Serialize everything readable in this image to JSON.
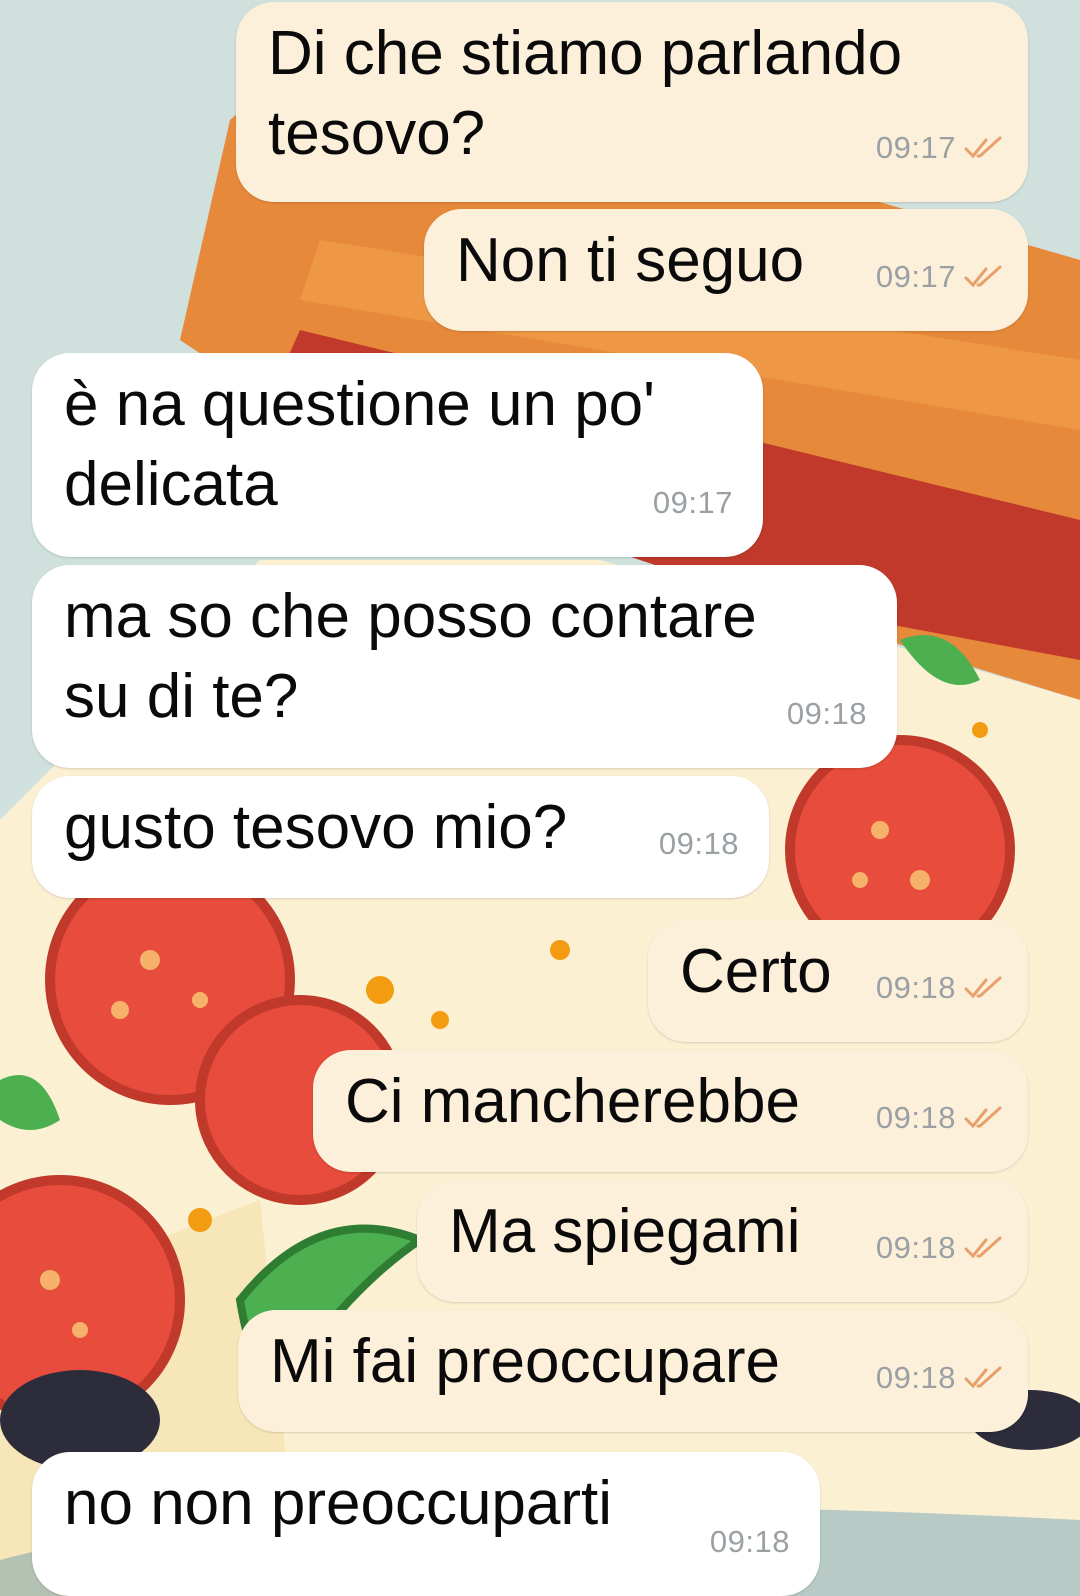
{
  "theme": {
    "outgoing_bubble": "#fdf0db",
    "incoming_bubble": "#ffffff",
    "time_color": "#9aa0a3",
    "tick_color": "#e8a06a"
  },
  "messages": [
    {
      "dir": "out",
      "text": "Di che stiamo parlando\ntesovo?",
      "time": "09:17",
      "status": "read-ticks-icon"
    },
    {
      "dir": "out",
      "text": "Non ti seguo",
      "time": "09:17",
      "status": "read-ticks-icon"
    },
    {
      "dir": "in",
      "text": "è na questione un po'\ndelicata",
      "time": "09:17"
    },
    {
      "dir": "in",
      "text": "ma so che posso contare\nsu di te?",
      "time": "09:18"
    },
    {
      "dir": "in",
      "text": "gusto tesovo mio?",
      "time": "09:18"
    },
    {
      "dir": "out",
      "text": "Certo",
      "time": "09:18",
      "status": "read-ticks-icon"
    },
    {
      "dir": "out",
      "text": "Ci mancherebbe",
      "time": "09:18",
      "status": "read-ticks-icon"
    },
    {
      "dir": "out",
      "text": "Ma spiegami",
      "time": "09:18",
      "status": "read-ticks-icon"
    },
    {
      "dir": "out",
      "text": "Mi fai preoccupare",
      "time": "09:18",
      "status": "read-ticks-icon"
    },
    {
      "dir": "in",
      "text": "no non preoccuparti",
      "time": "09:18"
    }
  ]
}
